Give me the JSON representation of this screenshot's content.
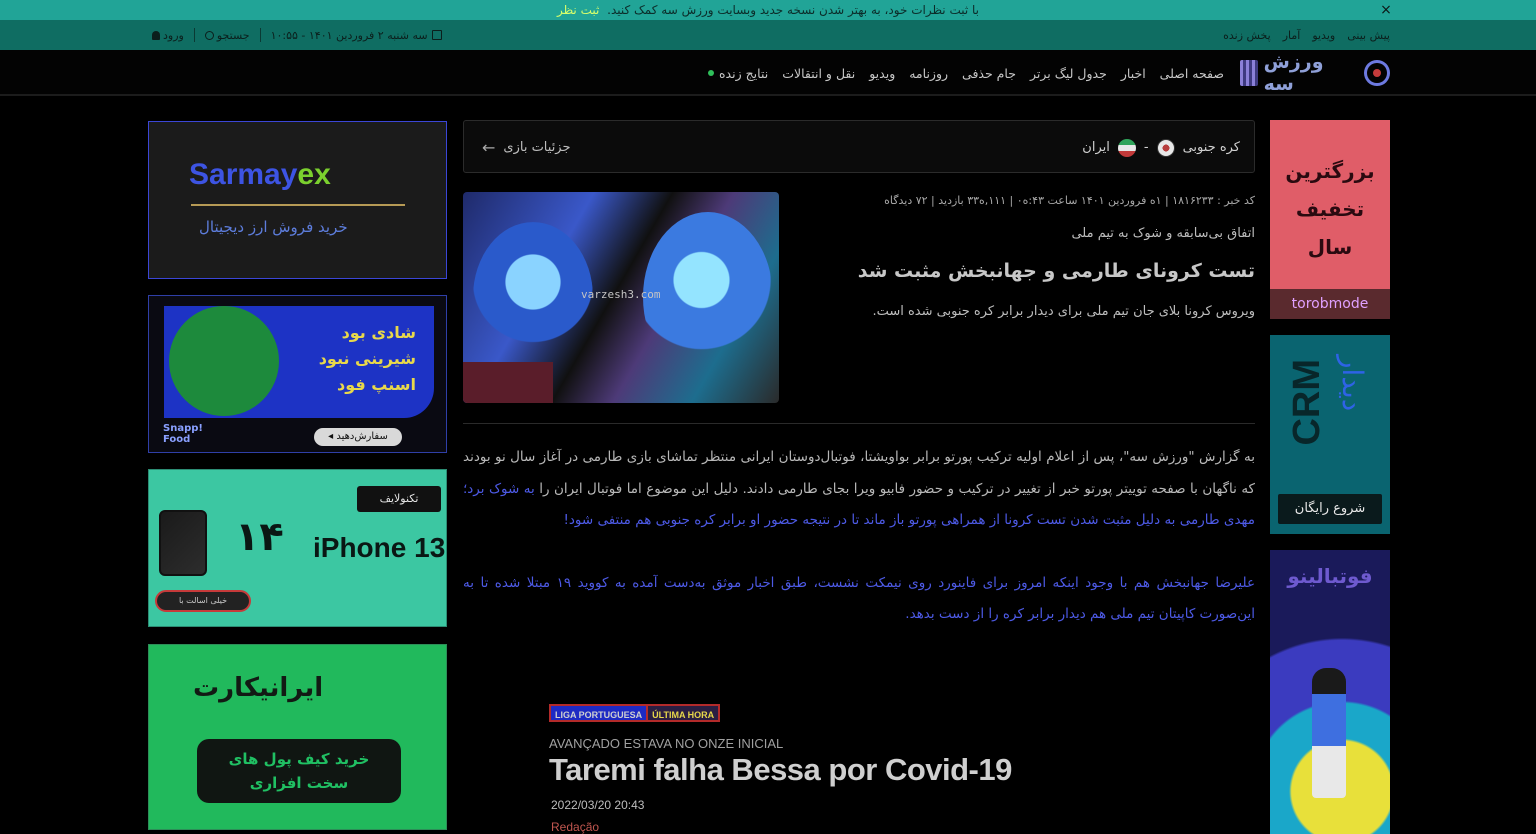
{
  "notice": {
    "text": "با ثبت نظرات خود، به بهتر شدن نسخه جدید وبسایت ورزش سه کمک کنید.",
    "link": "ثبت نظر",
    "close": "×"
  },
  "util": {
    "links": [
      "پیش بینی",
      "ویدیو",
      "آمار",
      "پخش زنده"
    ],
    "date": "سه شنبه ۲ فروردین ۱۴۰۱ - ۱۰:۵۵",
    "search": "جستجو",
    "login": "ورود"
  },
  "nav": {
    "logo": "ورزش سه",
    "items": [
      "صفحه اصلی",
      "اخبار",
      "جدول لیگ برتر",
      "جام حذفی",
      "روزنامه",
      "ویدیو",
      "نقل و انتقالات",
      "نتایج زنده"
    ]
  },
  "ads_left": {
    "sarmayex_brand_a": "Sarmay",
    "sarmayex_brand_b": "ex",
    "sarmayex_sub": "خرید فروش ارز دیجیتال",
    "snapp_line1": "شادی بود",
    "snapp_line2": "شیرینی نبود",
    "snapp_line3": "اسنپ فود",
    "snapp_brand1": "Snapp!",
    "snapp_brand2": "Food",
    "snapp_btn": "سفارش‌دهید ◂",
    "tech_brand": "تکنولایف",
    "tech_num": "۱۴",
    "tech_product": "iPhone 13",
    "tech_cta": "خیلی اسالت با",
    "irancard_logo": "ایرانیکارت",
    "irancard_line1": "خرید کیف پول های",
    "irancard_line2": "سخت افزاری"
  },
  "ads_right": {
    "torob_line1": "بزرگترین",
    "torob_line2": "تخفیف",
    "torob_line3": "سال",
    "torob_brand": "torobmode",
    "crm": "CRM",
    "crm_fa": "دیدار",
    "crm_btn": "شروع رایگان",
    "footballi": "فوتبالینو"
  },
  "match": {
    "home": "کره جنوبی",
    "away": "ایران",
    "sep": "-",
    "details": "جزئیات بازی"
  },
  "article": {
    "meta": "کد خبر : ۱۸۱۶۲۳۳ | ۱ه فروردین ۱۴۰۱ ساعت ۴۳:ه۰ | ۱۱۱,ه۳۳ بازدید | ۷۲ دیدگاه",
    "kicker": "اتفاق بی‌سابقه و شوک به تیم ملی",
    "title": "تست کرونای طارمی و جهانبخش مثبت شد",
    "lead": "ویروس کرونا بلای جان تیم ملی برای دیدار برابر کره جنوبی شده است.",
    "watermark": "varzesh3.com",
    "p1_plain": "به گزارش \"ورزش سه\"، پس از اعلام اولیه ترکیب پورتو برابر بواویشتا، فوتبال‌دوستان ایرانی منتظر تماشای بازی طارمی در آغاز سال نو بودند که ناگهان با صفحه توییتر پورتو خبر از تغییر در ترکیب و حضور فابیو ویرا بجای طارمی دادند. دلیل این موضوع اما فوتبال ایران را ",
    "p1_blue": "به شوک برد؛ مهدی طارمی به دلیل مثبت شدن تست کرونا از همراهی پورتو باز ماند تا در نتیجه حضور او برابر کره جنوبی هم منتفی شود!",
    "p2": "علیرضا جهانبخش هم با وجود اینکه امروز برای فاینورد روی نیمکت نشست، طبق اخبار موثق به‌دست آمده به کووید ۱۹ مبتلا شده تا به این‌صورت کاپیتان تیم ملی هم دیدار برابر کره را از دست بدهد."
  },
  "embed": {
    "tag1": "LIGA PORTUGUESA",
    "tag2": "ÚLTIMA HORA",
    "overline": "AVANÇADO ESTAVA NO ONZE INICIAL",
    "headline": "Taremi falha Bessa por Covid-19",
    "date": "2022/03/20 20:43",
    "byline": "Redação"
  }
}
